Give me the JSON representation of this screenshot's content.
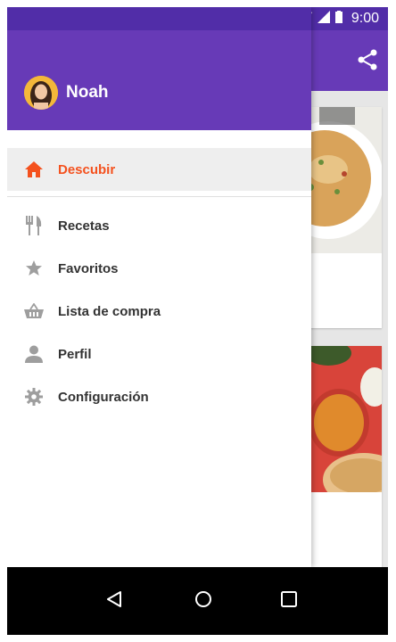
{
  "status_bar": {
    "time": "9:00"
  },
  "drawer": {
    "user_name": "Noah"
  },
  "menu": {
    "items": [
      {
        "label": "Descubir",
        "icon": "home-icon",
        "active": true
      },
      {
        "label": "Recetas",
        "icon": "restaurant-icon"
      },
      {
        "label": "Favoritos",
        "icon": "star-icon"
      },
      {
        "label": "Lista de compra",
        "icon": "basket-icon"
      },
      {
        "label": "Perfil",
        "icon": "person-icon"
      },
      {
        "label": "Configuración",
        "icon": "gear-icon"
      }
    ]
  },
  "colors": {
    "primary": "#673ab7",
    "primary_dark": "#512da8",
    "accent": "#f4511e",
    "icon_gray": "#9e9e9e"
  }
}
